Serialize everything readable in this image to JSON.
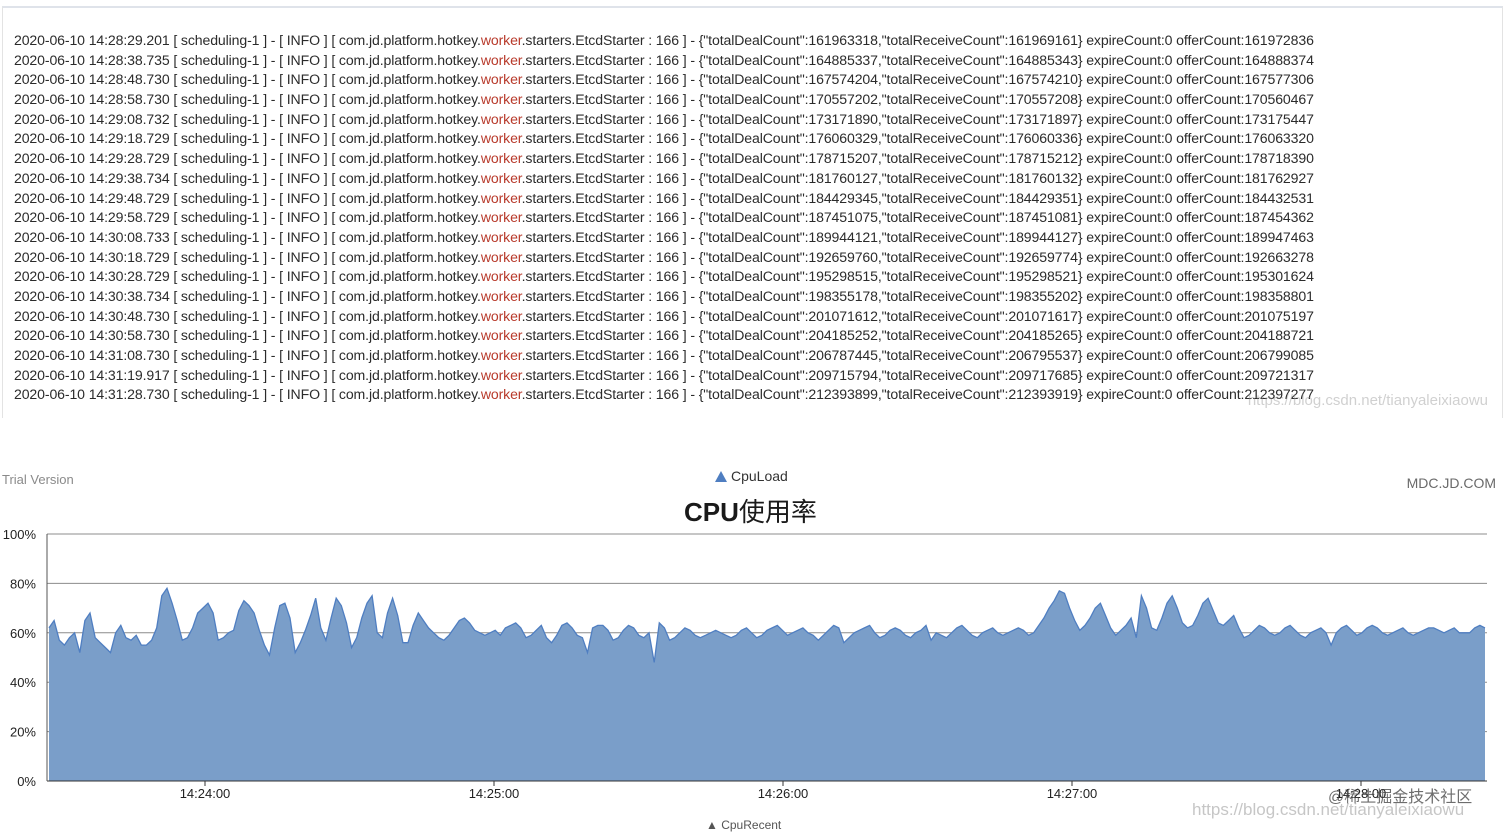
{
  "log": {
    "keyword": "worker",
    "lines": [
      {
        "ts": "2020-06-10 14:28:29.201",
        "deal": "161963318",
        "receive": "161969161",
        "offer": "161972836"
      },
      {
        "ts": "2020-06-10 14:28:38.735",
        "deal": "164885337",
        "receive": "164885343",
        "offer": "164888374"
      },
      {
        "ts": "2020-06-10 14:28:48.730",
        "deal": "167574204",
        "receive": "167574210",
        "offer": "167577306"
      },
      {
        "ts": "2020-06-10 14:28:58.730",
        "deal": "170557202",
        "receive": "170557208",
        "offer": "170560467"
      },
      {
        "ts": "2020-06-10 14:29:08.732",
        "deal": "173171890",
        "receive": "173171897",
        "offer": "173175447"
      },
      {
        "ts": "2020-06-10 14:29:18.729",
        "deal": "176060329",
        "receive": "176060336",
        "offer": "176063320"
      },
      {
        "ts": "2020-06-10 14:29:28.729",
        "deal": "178715207",
        "receive": "178715212",
        "offer": "178718390"
      },
      {
        "ts": "2020-06-10 14:29:38.734",
        "deal": "181760127",
        "receive": "181760132",
        "offer": "181762927"
      },
      {
        "ts": "2020-06-10 14:29:48.729",
        "deal": "184429345",
        "receive": "184429351",
        "offer": "184432531"
      },
      {
        "ts": "2020-06-10 14:29:58.729",
        "deal": "187451075",
        "receive": "187451081",
        "offer": "187454362"
      },
      {
        "ts": "2020-06-10 14:30:08.733",
        "deal": "189944121",
        "receive": "189944127",
        "offer": "189947463"
      },
      {
        "ts": "2020-06-10 14:30:18.729",
        "deal": "192659760",
        "receive": "192659774",
        "offer": "192663278"
      },
      {
        "ts": "2020-06-10 14:30:28.729",
        "deal": "195298515",
        "receive": "195298521",
        "offer": "195301624"
      },
      {
        "ts": "2020-06-10 14:30:38.734",
        "deal": "198355178",
        "receive": "198355202",
        "offer": "198358801"
      },
      {
        "ts": "2020-06-10 14:30:48.730",
        "deal": "201071612",
        "receive": "201071617",
        "offer": "201075197"
      },
      {
        "ts": "2020-06-10 14:30:58.730",
        "deal": "204185252",
        "receive": "204185265",
        "offer": "204188721"
      },
      {
        "ts": "2020-06-10 14:31:08.730",
        "deal": "206787445",
        "receive": "206795537",
        "offer": "206799085"
      },
      {
        "ts": "2020-06-10 14:31:19.917",
        "deal": "209715794",
        "receive": "209717685",
        "offer": "209721317"
      },
      {
        "ts": "2020-06-10 14:31:28.730",
        "deal": "212393899",
        "receive": "212393919",
        "offer": "212397277"
      }
    ],
    "watermark": "https://blog.csdn.net/tianyaleixiaowu"
  },
  "chart_header": {
    "trial": "Trial Version",
    "brand": "MDC.JD.COM",
    "title_a": "CPU",
    "title_b": "使用率",
    "bottom_partial": "▲ CpuRecent"
  },
  "chart_data": {
    "type": "area",
    "title": "CPU使用率",
    "series": [
      {
        "name": "CpuLoad"
      }
    ],
    "legend_position": "top-center",
    "ylim": [
      0,
      100
    ],
    "yticks": [
      "0%",
      "20%",
      "40%",
      "60%",
      "80%",
      "100%"
    ],
    "xticks": [
      "14:24:00",
      "14:25:00",
      "14:26:00",
      "14:27:00",
      "14:28:00"
    ],
    "grid": true,
    "color": "#7a9ec9",
    "line_color": "#4f7ec1",
    "values": [
      62,
      65,
      57,
      55,
      58,
      60,
      62,
      65,
      68,
      58,
      56,
      54,
      52,
      60,
      63,
      58,
      57,
      59,
      60,
      55,
      57,
      62,
      75,
      78,
      72,
      65,
      57,
      58,
      62,
      68,
      70,
      72,
      68,
      57,
      58,
      60,
      61,
      69,
      73,
      71,
      68,
      61,
      55,
      51,
      62,
      71,
      72,
      66,
      52,
      56,
      61,
      67,
      74,
      62,
      57,
      66,
      74,
      71,
      64,
      54,
      58,
      66,
      72,
      75,
      60,
      58,
      68,
      74,
      67,
      56,
      56,
      63,
      68,
      65,
      62,
      60,
      58,
      57,
      59,
      62,
      65,
      66,
      64,
      61,
      60,
      59,
      60,
      61,
      59,
      62,
      63,
      64,
      62,
      58,
      59,
      61,
      63,
      58,
      56,
      59,
      63,
      64,
      62,
      59,
      58,
      60,
      62,
      63,
      63,
      61,
      57,
      58,
      61,
      63,
      62,
      59,
      58,
      60,
      61,
      64,
      62,
      57,
      58,
      60,
      62,
      61,
      59,
      58,
      59,
      60,
      61,
      60,
      59,
      58,
      59,
      61,
      62,
      60,
      58,
      59,
      61,
      62,
      63,
      61,
      59,
      60,
      61,
      62,
      60,
      59,
      57,
      59,
      61,
      63,
      62,
      59,
      58,
      60,
      61,
      62,
      63,
      60,
      58,
      59,
      61,
      62,
      61,
      59,
      58,
      60,
      61,
      63,
      62,
      60,
      59,
      58,
      60,
      62,
      63,
      61,
      59,
      58,
      60,
      61,
      62,
      60,
      59,
      60,
      61,
      62,
      61,
      59,
      60,
      63,
      66,
      70,
      73,
      77,
      76,
      70,
      65,
      61,
      63,
      66,
      70,
      72,
      67,
      62,
      59,
      61,
      63,
      66,
      72,
      75,
      70,
      62,
      61,
      66,
      72,
      75,
      70,
      64,
      62,
      63,
      67,
      72,
      74,
      69,
      64,
      63,
      65,
      67,
      62,
      58,
      59,
      61,
      63,
      62,
      60,
      59,
      60,
      62,
      63,
      61,
      59,
      58,
      60,
      61,
      62,
      60,
      59,
      60,
      62,
      63,
      61,
      59,
      60,
      62,
      63,
      62,
      60,
      59,
      60,
      61,
      62,
      60,
      59,
      60,
      61,
      62,
      62,
      61,
      60,
      61,
      62,
      61,
      60,
      60,
      62,
      63,
      62
    ],
    "dips": [
      [
        6,
        52
      ],
      [
        18,
        55
      ],
      [
        43,
        51
      ],
      [
        48,
        52
      ],
      [
        69,
        56
      ],
      [
        105,
        52
      ],
      [
        118,
        48
      ],
      [
        155,
        56
      ],
      [
        172,
        57
      ],
      [
        212,
        58
      ],
      [
        250,
        55
      ],
      [
        275,
        60
      ]
    ],
    "x_range": [
      "14:23:30",
      "14:28:30"
    ]
  },
  "watermarks": {
    "chart": "@稀土掘金技术社区",
    "url": "https://blog.csdn.net/tianyaleixiaowu"
  }
}
